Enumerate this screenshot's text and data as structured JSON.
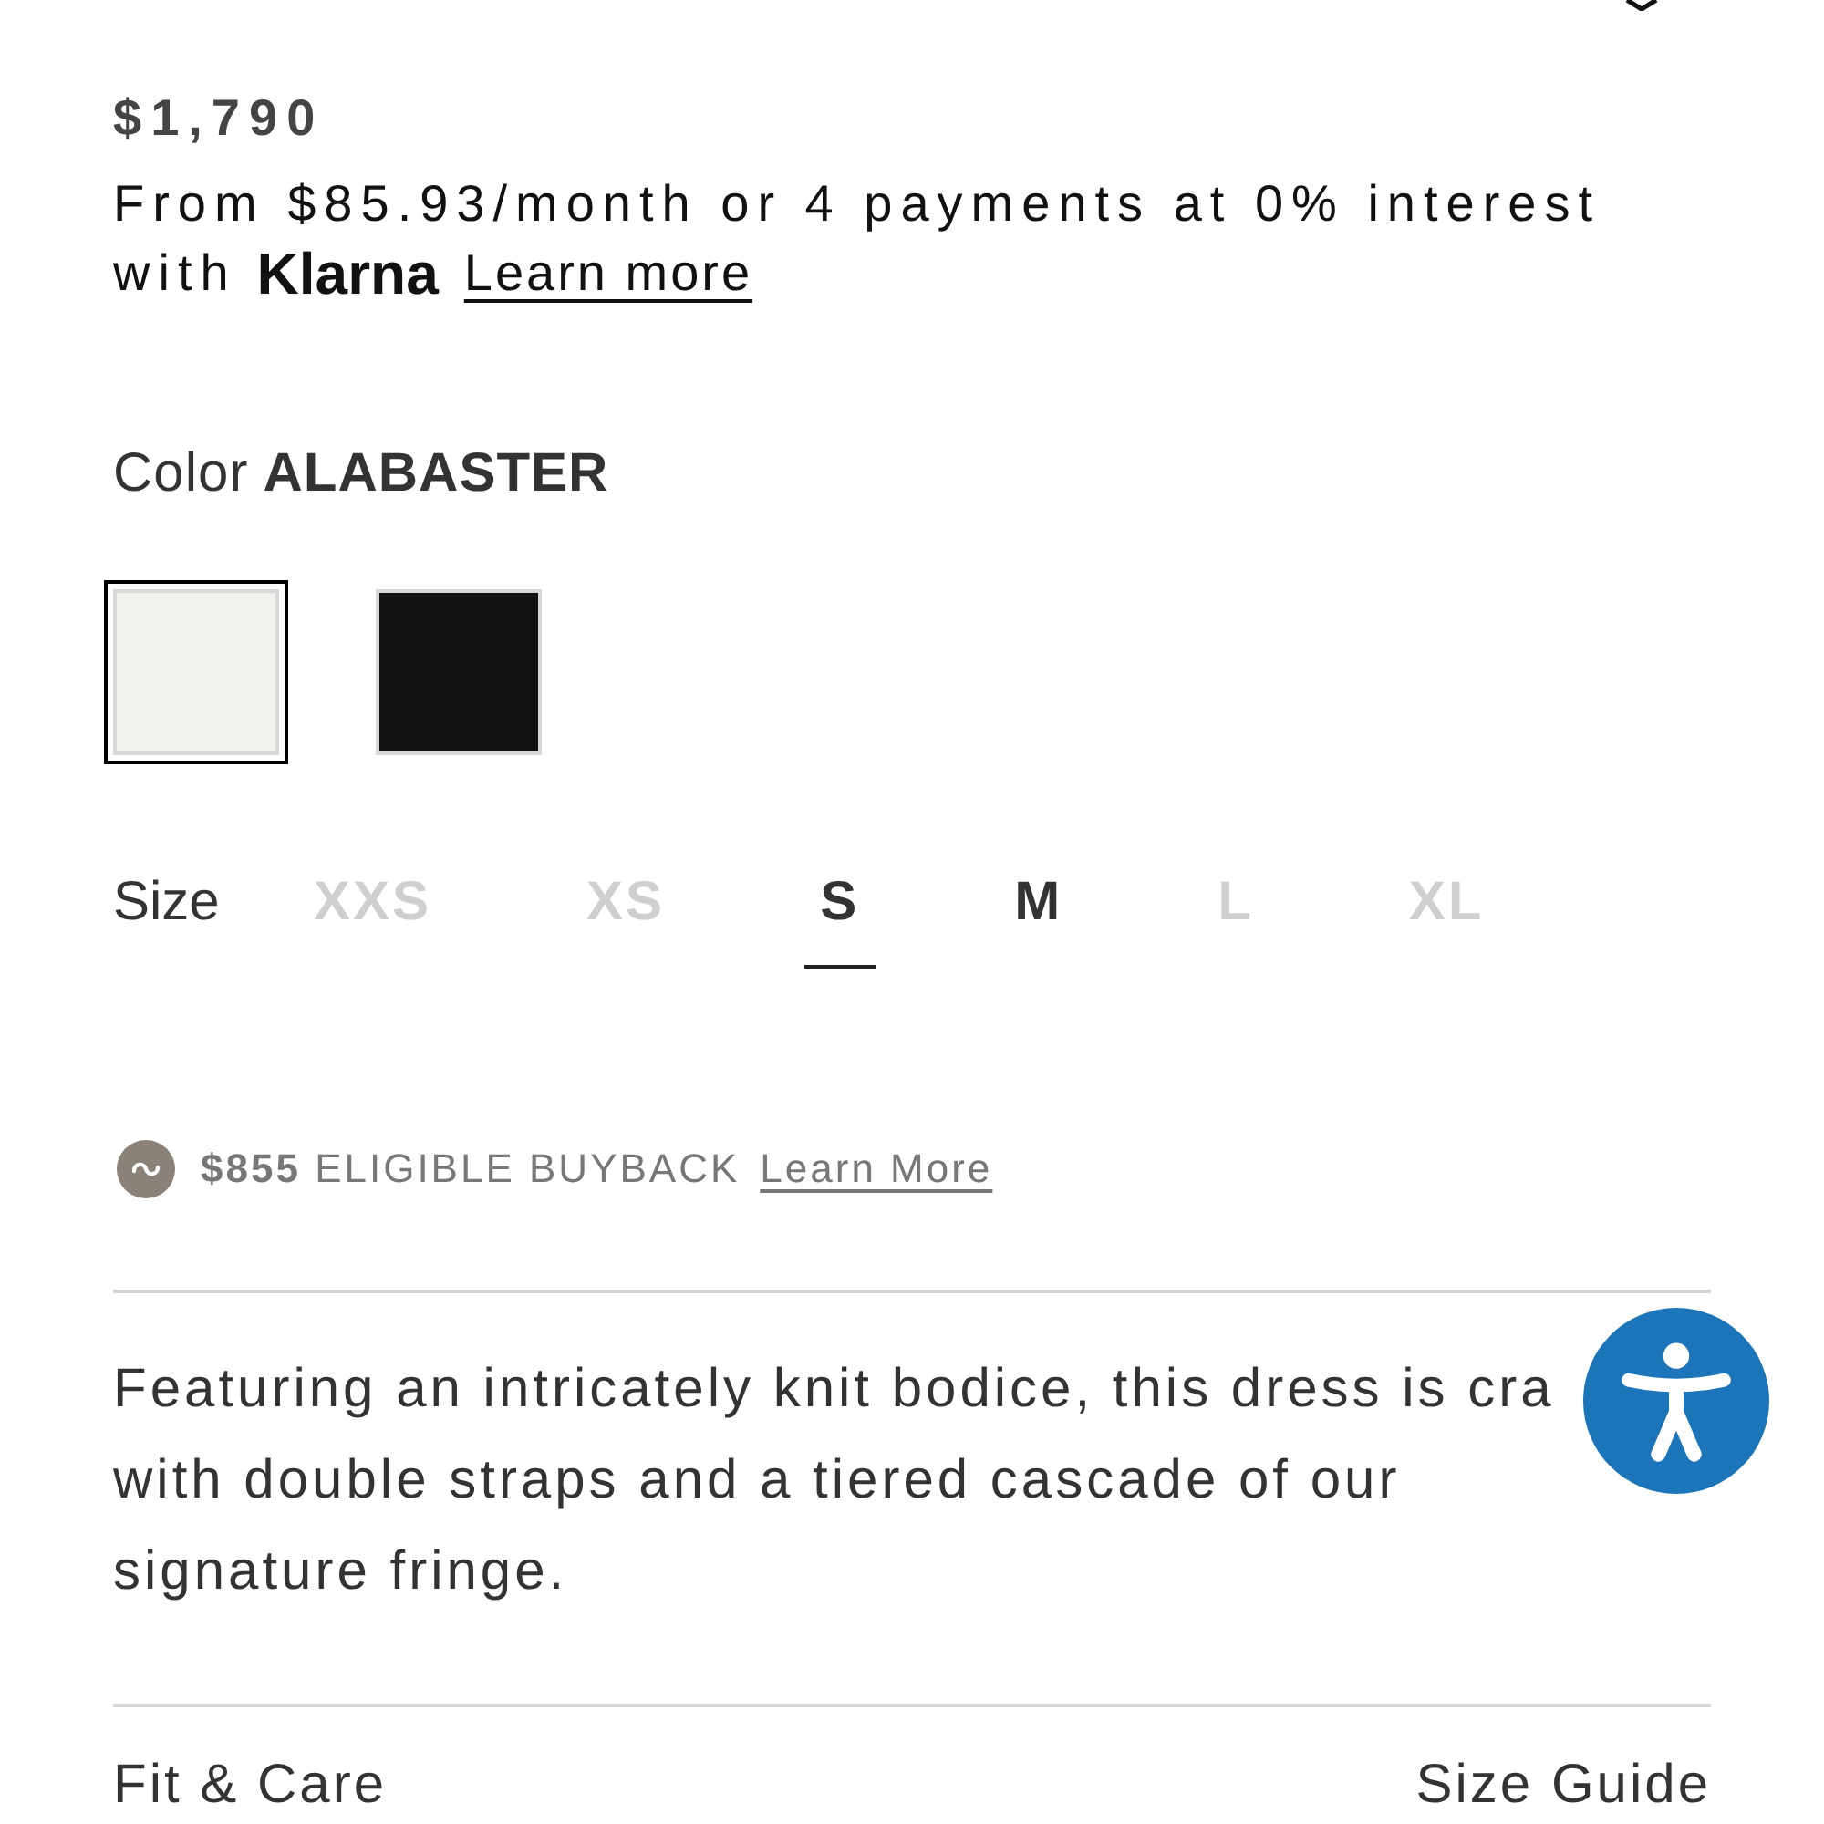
{
  "price": "$1,790",
  "financing": {
    "offer": "From $85.93/month or 4 payments at 0% interest",
    "joiner": "with",
    "provider": "Klarna",
    "link": "Learn more"
  },
  "color": {
    "label": "Color",
    "value": "ALABASTER",
    "swatches": [
      {
        "color": "#f1f1ee",
        "selected": true
      },
      {
        "color": "#121212",
        "selected": false
      }
    ]
  },
  "size": {
    "label": "Size",
    "options": [
      {
        "label": "XXS",
        "available": false,
        "selected": false
      },
      {
        "label": "XS",
        "available": false,
        "selected": false
      },
      {
        "label": "S",
        "available": true,
        "selected": true
      },
      {
        "label": "M",
        "available": true,
        "selected": false
      },
      {
        "label": "L",
        "available": false,
        "selected": false
      },
      {
        "label": "XL",
        "available": false,
        "selected": false
      }
    ]
  },
  "buyback": {
    "text": "**$855** ELIGIBLE BUYBACK",
    "link": "Learn More"
  },
  "description": {
    "lines": [
      "Featuring an intricately knit bodice, this dress is cra",
      "with double straps and a tiered cascade of our",
      "signature fringe."
    ]
  },
  "sections": [
    {
      "label": "Fit & Care"
    },
    {
      "label": "Size Guide"
    }
  ]
}
